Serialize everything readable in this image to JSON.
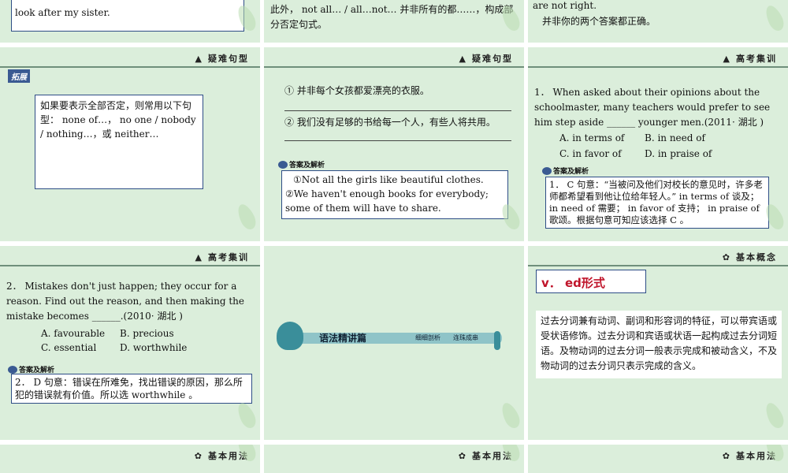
{
  "slide1": {
    "text": "look after my sister."
  },
  "slide2": {
    "text": "此外， not all… / all…not… 并非所有的都……，构成部分否定句式。"
  },
  "slide3": {
    "text1": "are not right.",
    "text2": "并非你的两个答案都正确。"
  },
  "slide4": {
    "header": "疑难句型",
    "badge": "拓展",
    "box": "如果要表示全部否定，则常用以下句型： none of…， no one / nobody / nothing…，或 neither…"
  },
  "slide5": {
    "header": "疑难句型",
    "item1": "① 并非每个女孩都爱漂亮的衣服。",
    "item2": "② 我们没有足够的书给每一个人，有些人将共用。",
    "answer_label": "答案及解析",
    "answer1": "①Not all the girls like beautiful clothes.",
    "answer2": "②We haven't enough books for everybody; some of them will have to share."
  },
  "slide6": {
    "header": "高考集训",
    "question": "1． When asked about their opinions about the schoolmaster, many teachers would prefer to see him step aside ______ younger men.(2011· 湖北 )",
    "options": [
      "A. in terms of",
      "B. in need of",
      "C. in favor of",
      "D. in praise of"
    ],
    "answer_label": "答案及解析",
    "answer": "1． C 句意：“当被问及他们对校长的意见时，许多老师都希望看到他让位给年轻人。” in terms of 谈及； in need of 需要； in favor of 支持； in praise of 歌颂。根据句意可知应该选择 C 。"
  },
  "slide7": {
    "header": "高考集训",
    "question": "2． Mistakes don't just happen; they occur for a reason. Find out the reason, and then making the mistake becomes ______.(2010· 湖北 )",
    "options": [
      "A. favourable",
      "B. precious",
      "C. essential",
      "D. worthwhile"
    ],
    "answer_label": "答案及解析",
    "answer": "2． D 句意：错误在所难免，找出错误的原因，那么所犯的错误就有价值。所以选 worthwhile 。"
  },
  "slide8": {
    "banner": "语法精讲篇",
    "tag1": "细细剖析",
    "tag2": "连珠成串"
  },
  "slide9": {
    "header": "基本概念",
    "title": "v． ed形式",
    "body": "过去分词兼有动词、副词和形容词的特征，可以带宾语或受状语修饰。过去分词和宾语或状语一起构成过去分词短语。及物动词的过去分词一般表示完成和被动含义，不及物动词的过去分词只表示完成的含义。"
  },
  "slide10": {
    "header": "基本用法"
  },
  "slide11": {
    "header": "基本用法"
  },
  "slide12": {
    "header": "基本用法"
  },
  "colors": {
    "slide_bg": "#dbeedb",
    "border": "#2e4d86",
    "title_red": "#c0142a"
  }
}
